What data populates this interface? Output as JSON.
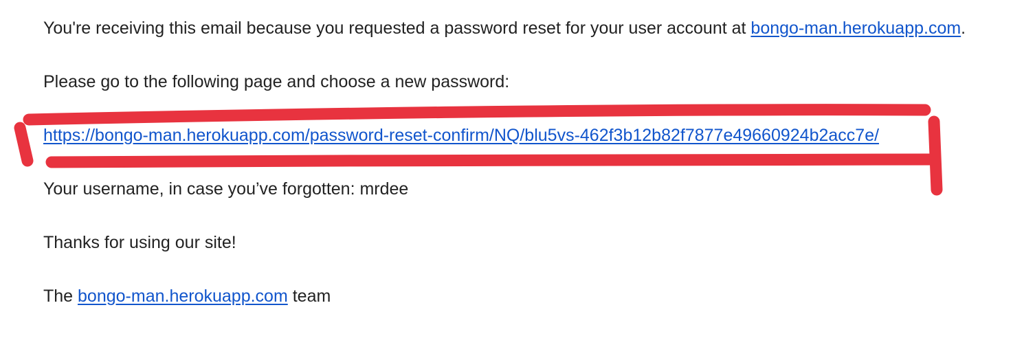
{
  "email": {
    "intro": {
      "text_before": "You're receiving this email because you requested a password reset for your user account at ",
      "site_link": "bongo-man.herokuapp.com",
      "text_after": "."
    },
    "instruction": "Please go to the following page and choose a new password:",
    "reset_link": "https://bongo-man.herokuapp.com/password-reset-confirm/NQ/blu5vs-462f3b12b82f7877e49660924b2acc7e/",
    "username_line": "Your username, in case you’ve forgotten: mrdee",
    "thanks": "Thanks for using our site!",
    "signoff": {
      "text_before": "The ",
      "site_link": "bongo-man.herokuapp.com",
      "text_after": " team"
    }
  },
  "annotation": {
    "stroke_color": "#e8333f"
  }
}
